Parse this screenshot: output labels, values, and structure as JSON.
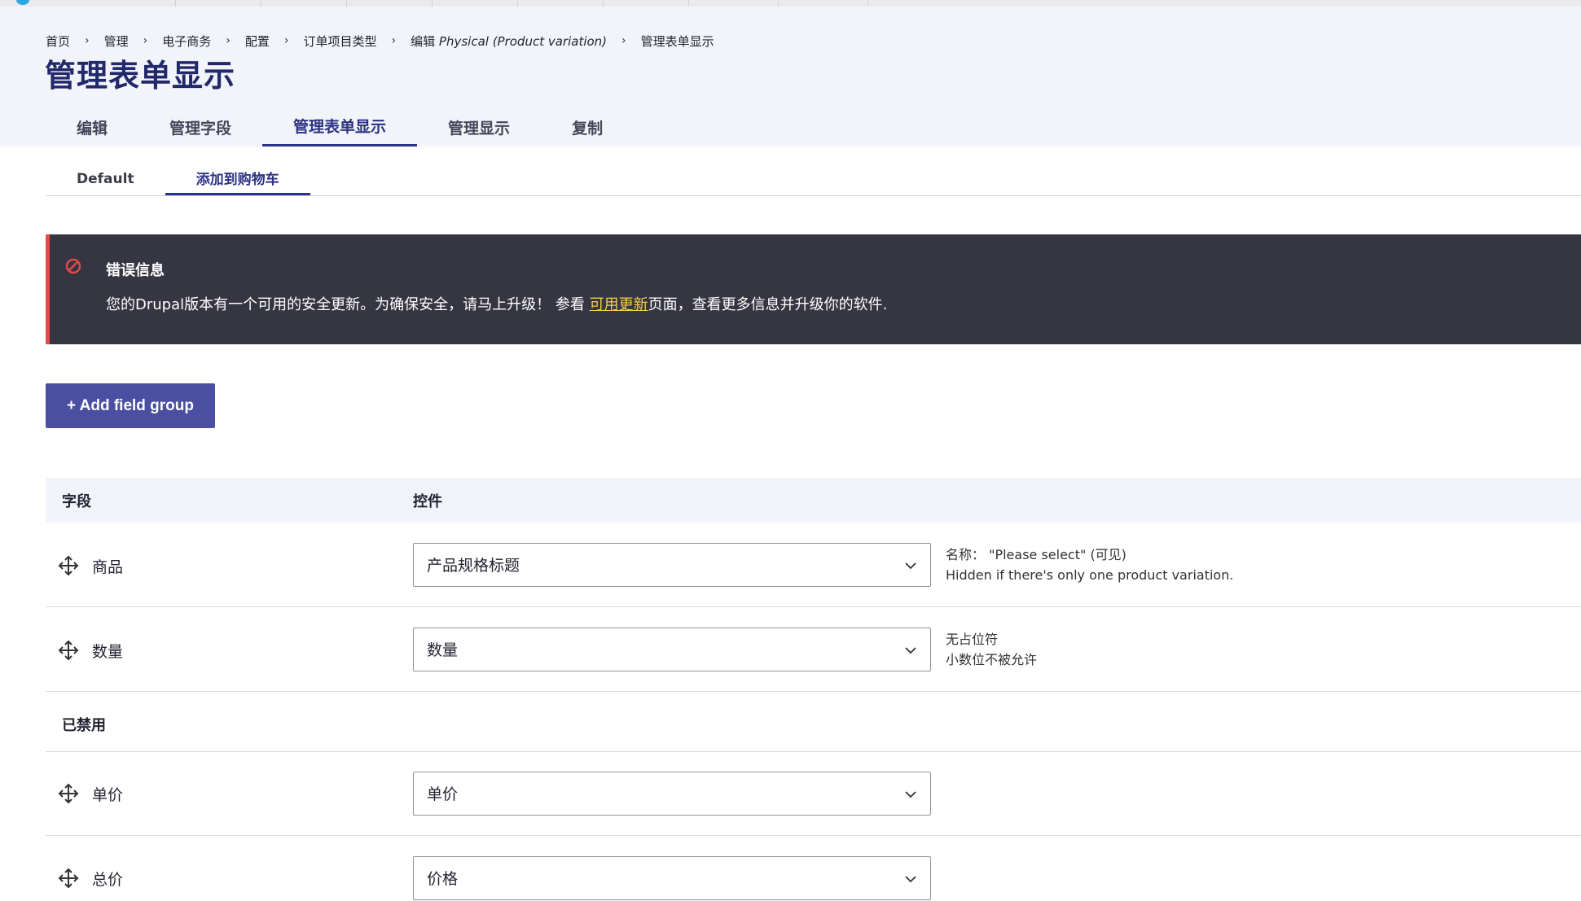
{
  "breadcrumb": {
    "items": [
      "首页",
      "管理",
      "电子商务",
      "配置",
      "订单项目类型"
    ],
    "edit_prefix": "编辑 ",
    "edit_entity": "Physical (Product variation)",
    "current": "管理表单显示"
  },
  "page_title": "管理表单显示",
  "primary_tabs": [
    "编辑",
    "管理字段",
    "管理表单显示",
    "管理显示",
    "复制"
  ],
  "primary_active_index": 2,
  "secondary_tabs": [
    "Default",
    "添加到购物车"
  ],
  "secondary_active_index": 1,
  "error": {
    "title": "错误信息",
    "text_before": "您的Drupal版本有一个可用的安全更新。为确保安全，请马上升级！ 参看 ",
    "link": "可用更新",
    "text_after": "页面，查看更多信息并升级你的软件.",
    "icon": "error-circle-icon",
    "accent_color": "#e34a4a",
    "link_color": "#f4cf4a"
  },
  "add_field_group_label": "+ Add field group",
  "table": {
    "headers": {
      "field": "字段",
      "widget": "控件"
    },
    "rows": [
      {
        "label": "商品",
        "widget": "产品规格标题",
        "summary": [
          "名称： \"Please select\" (可见)",
          "Hidden if there's only one product variation."
        ]
      },
      {
        "label": "数量",
        "widget": "数量",
        "summary": [
          "无占位符",
          "小数位不被允许"
        ]
      }
    ],
    "disabled_title": "已禁用",
    "disabled_rows": [
      {
        "label": "单价",
        "widget": "单价"
      },
      {
        "label": "总价",
        "widget": "价格"
      }
    ]
  },
  "colors": {
    "primary": "#2b3384",
    "button": "#4a4fa2",
    "header_bg": "#f3f4f9",
    "error_bg": "#353641"
  }
}
